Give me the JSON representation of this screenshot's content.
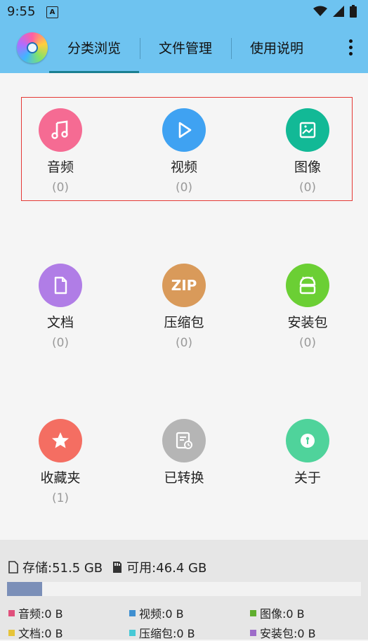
{
  "status": {
    "time": "9:55",
    "notif_letter": "A"
  },
  "appbar": {
    "tabs": [
      {
        "label": "分类浏览",
        "active": true
      },
      {
        "label": "文件管理",
        "active": false
      },
      {
        "label": "使用说明",
        "active": false
      }
    ]
  },
  "categories": [
    {
      "label": "音频",
      "count": "(0)",
      "icon": "music-icon",
      "color": "#f56b93"
    },
    {
      "label": "视频",
      "count": "(0)",
      "icon": "play-icon",
      "color": "#3fa2f2"
    },
    {
      "label": "图像",
      "count": "(0)",
      "icon": "image-icon",
      "color": "#12b996"
    },
    {
      "label": "文档",
      "count": "(0)",
      "icon": "document-icon",
      "color": "#b07de6"
    },
    {
      "label": "压缩包",
      "count": "(0)",
      "icon": "zip-icon",
      "color": "#d99a5a",
      "icon_text": "ZIP"
    },
    {
      "label": "安装包",
      "count": "(0)",
      "icon": "android-icon",
      "color": "#6bcf34"
    },
    {
      "label": "收藏夹",
      "count": "(1)",
      "icon": "star-icon",
      "color": "#f46e62"
    },
    {
      "label": "已转换",
      "count": "",
      "icon": "converted-icon",
      "color": "#b5b5b5"
    },
    {
      "label": "关于",
      "count": "",
      "icon": "info-icon",
      "color": "#4fd39b"
    }
  ],
  "storage": {
    "total": "存储:51.5 GB",
    "available": "可用:46.4 GB",
    "used_fraction": 0.1
  },
  "legend": [
    {
      "label": "音频:0 B",
      "color": "#e0507c"
    },
    {
      "label": "视频:0 B",
      "color": "#3f8fd0"
    },
    {
      "label": "图像:0 B",
      "color": "#5fae2e"
    },
    {
      "label": "文档:0 B",
      "color": "#e6c43a"
    },
    {
      "label": "压缩包:0 B",
      "color": "#47c9d6"
    },
    {
      "label": "安装包:0 B",
      "color": "#9d6cc9"
    }
  ]
}
